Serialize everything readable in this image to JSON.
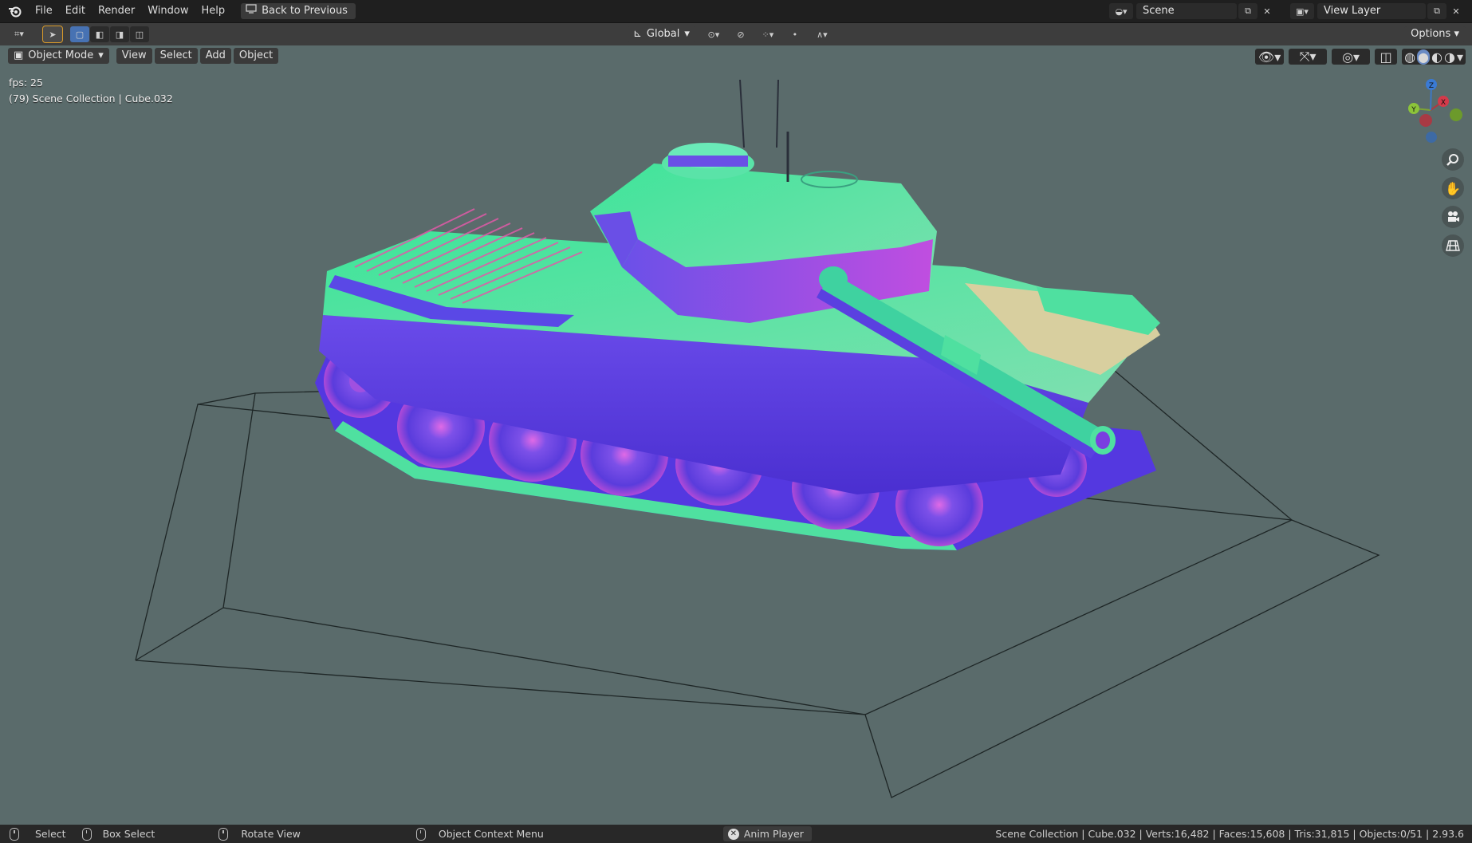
{
  "topbar": {
    "menu": [
      "File",
      "Edit",
      "Render",
      "Window",
      "Help"
    ],
    "back_button": "Back to Previous",
    "scene_name": "Scene",
    "view_layer": "View Layer"
  },
  "toolbar": {
    "transform_orientation": "Global",
    "options_label": "Options"
  },
  "viewport_header": {
    "mode": "Object Mode",
    "menus": [
      "View",
      "Select",
      "Add",
      "Object"
    ]
  },
  "overlay": {
    "fps": "fps: 25",
    "collection_info": "(79) Scene Collection | Cube.032"
  },
  "axes": {
    "x": "X",
    "y": "Y",
    "z": "Z"
  },
  "statusbar": {
    "select": "Select",
    "box_select": "Box Select",
    "rotate_view": "Rotate View",
    "context_menu": "Object Context Menu",
    "anim_player": "Anim Player",
    "stats": "Scene Collection | Cube.032 | Verts:16,482 | Faces:15,608 | Tris:31,815 | Objects:0/51 | 2.93.6"
  },
  "colors": {
    "viewport_bg": "#5a6b6b",
    "topbar": "#1f1f1f",
    "tank_blue": "#5a3fe0",
    "tank_green": "#4fe0a0",
    "tank_pink": "#e05ad0",
    "axis_x": "#d43a4a",
    "axis_y": "#8cc43a",
    "axis_z": "#3a7ad4"
  }
}
